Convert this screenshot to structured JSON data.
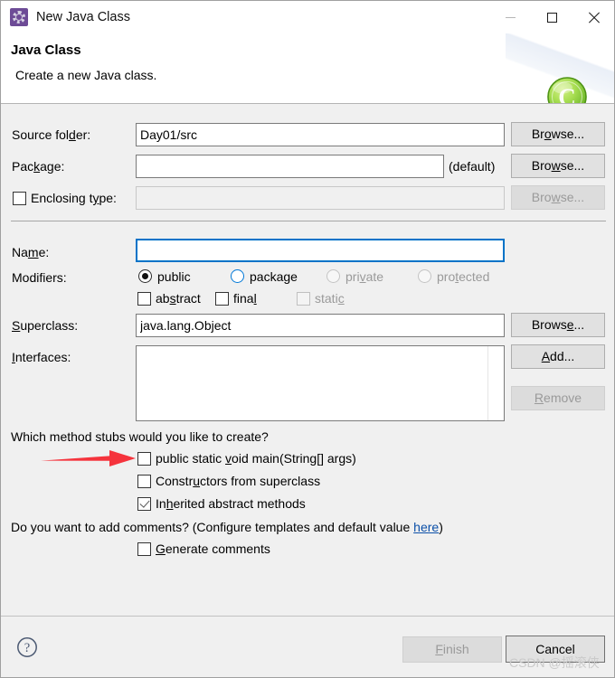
{
  "window": {
    "title": "New Java Class",
    "icon": "java-class-wizard-icon",
    "minimize": "–",
    "maximize": "□",
    "close": "✕"
  },
  "banner": {
    "title": "Java Class",
    "subtitle": "Create a new Java class.",
    "logo": "green-class-icon"
  },
  "form": {
    "source_folder": {
      "label_pre": "Source fol",
      "label_key": "d",
      "label_post": "er:",
      "value": "Day01/src",
      "browse_pre": "Br",
      "browse_key": "o",
      "browse_post": "wse..."
    },
    "package": {
      "label_pre": "Pac",
      "label_key": "k",
      "label_post": "age:",
      "value": "",
      "default_hint": "(default)",
      "browse_pre": "Bro",
      "browse_key": "w",
      "browse_post": "se..."
    },
    "enclosing_type": {
      "label_pre": "Enclosing t",
      "label_key": "y",
      "label_post": "pe:",
      "checked": false,
      "value": "",
      "browse_pre": "Bro",
      "browse_key": "w",
      "browse_post": "se...",
      "disabled": true
    },
    "name": {
      "label_pre": "Na",
      "label_key": "m",
      "label_post": "e:",
      "value": "",
      "focused": true
    },
    "modifiers": {
      "label": "Modifiers:",
      "radios": [
        {
          "label": "public",
          "state": "selected"
        },
        {
          "label": "package",
          "state": "hover"
        },
        {
          "label_pre": "pri",
          "label_key": "v",
          "label_post": "ate",
          "state": "disabled"
        },
        {
          "label_pre": "pro",
          "label_key": "t",
          "label_post": "ected",
          "state": "disabled"
        }
      ],
      "checkboxes": [
        {
          "label_pre": "ab",
          "label_key": "s",
          "label_post": "tract",
          "checked": false,
          "disabled": false
        },
        {
          "label_pre": "fina",
          "label_key": "l",
          "label_post": "",
          "checked": false,
          "disabled": false
        },
        {
          "label_pre": "stati",
          "label_key": "c",
          "label_post": "",
          "checked": false,
          "disabled": true
        }
      ]
    },
    "superclass": {
      "label_pre": "",
      "label_key": "S",
      "label_post": "uperclass:",
      "value": "java.lang.Object",
      "browse_pre": "Brows",
      "browse_key": "e",
      "browse_post": "..."
    },
    "interfaces": {
      "label_pre": "",
      "label_key": "I",
      "label_post": "nterfaces:",
      "items": [],
      "add_pre": "",
      "add_key": "A",
      "add_post": "dd...",
      "remove_pre": "",
      "remove_key": "R",
      "remove_post": "emove",
      "remove_disabled": true
    }
  },
  "stubs": {
    "question": "Which method stubs would you like to create?",
    "options": [
      {
        "label_pre": "public static ",
        "label_key": "v",
        "label_post": "oid main(String[] args)",
        "checked": false
      },
      {
        "label_pre": "Constr",
        "label_key": "u",
        "label_post": "ctors from superclass",
        "checked": false
      },
      {
        "label_pre": "In",
        "label_key": "h",
        "label_post": "erited abstract methods",
        "checked": true
      }
    ]
  },
  "comments": {
    "question_pre": "Do you want to add comments? (Configure templates and default value ",
    "link": "here",
    "question_post": ")",
    "generate": {
      "label_pre": "",
      "label_key": "G",
      "label_post": "enerate comments",
      "checked": false
    }
  },
  "footer": {
    "help": "help-icon",
    "finish_pre": "",
    "finish_key": "F",
    "finish_post": "inish",
    "finish_disabled": true,
    "cancel": "Cancel"
  },
  "watermark": "CSDN @摇滚侠",
  "colors": {
    "dialog_bg": "#f0f0f0",
    "banner_bg": "#ffffff",
    "accent_focus": "#0073c8",
    "link": "#0b4fa8",
    "annotation_arrow": "#f5333c",
    "title_icon": "#6d4b96",
    "logo_green": "#78c832"
  }
}
